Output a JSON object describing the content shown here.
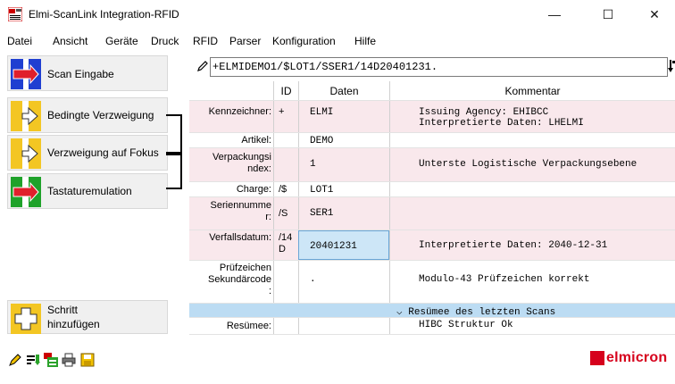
{
  "window": {
    "title": "Elmi-ScanLink Integration-RFID",
    "minimize_glyph": "—",
    "maximize_glyph": "☐",
    "close_glyph": "✕"
  },
  "menu": [
    {
      "label": "Datei"
    },
    {
      "label": "Ansicht"
    },
    {
      "label": "Geräte"
    },
    {
      "label": "Druck"
    },
    {
      "label": "RFID"
    },
    {
      "label": "Parser"
    },
    {
      "label": "Konfiguration"
    },
    {
      "label": "Hilfe"
    }
  ],
  "sidebar": {
    "steps": [
      {
        "label": "Scan Eingabe",
        "icon": "scan-input-icon"
      },
      {
        "label": "Bedingte Verzweigung",
        "icon": "conditional-branch-icon"
      },
      {
        "label": "Verzweigung auf Fokus",
        "icon": "focus-branch-icon"
      },
      {
        "label": "Tastaturemulation",
        "icon": "keyboard-emulation-icon"
      }
    ],
    "add_step_line1": "Schritt",
    "add_step_line2": "hinzufügen"
  },
  "scan": {
    "value": "+ELMIDEMO1/$LOT1/SSER1/14D20401231."
  },
  "grid": {
    "headers": {
      "label": "",
      "id": "ID",
      "data": "Daten",
      "comment": "Kommentar"
    },
    "rows": [
      {
        "label": "Kennzeichner:",
        "id": "+",
        "data": "ELMI",
        "comment1": "Issuing Agency: EHIBCC",
        "comment2": "Interpretierte Daten: LHELMI"
      },
      {
        "label": "Artikel:",
        "id": "",
        "data": "DEMO",
        "comment1": "",
        "comment2": ""
      },
      {
        "label1": "Verpackungsi",
        "label2": "ndex:",
        "id": "",
        "data": "1",
        "comment1": "Unterste Logistische Verpackungsebene"
      },
      {
        "label": "Charge:",
        "id": "/$",
        "data": "LOT1",
        "comment1": ""
      },
      {
        "label1": "Seriennumme",
        "label2": "r:",
        "id": "/S",
        "data": "SER1",
        "comment1": ""
      },
      {
        "label": "Verfallsdatum:",
        "id1": "/14",
        "id2": "D",
        "data": "20401231",
        "comment1": "Interpretierte Daten: 2040-12-31"
      },
      {
        "label1": "Prüfzeichen",
        "label2": "Sekundärcode",
        "label3": ":",
        "id": "",
        "data": ".",
        "comment1": "Modulo-43 Prüfzeichen korrekt"
      },
      {
        "group_label": "Resümee des letzten Scans",
        "group_icon": "chevron-down-icon"
      },
      {
        "label": "Resümee:",
        "comment1": "HIBC Struktur Ok"
      }
    ]
  },
  "bottom": {
    "brand": "elmicron",
    "brand_color": "#d6001c"
  }
}
